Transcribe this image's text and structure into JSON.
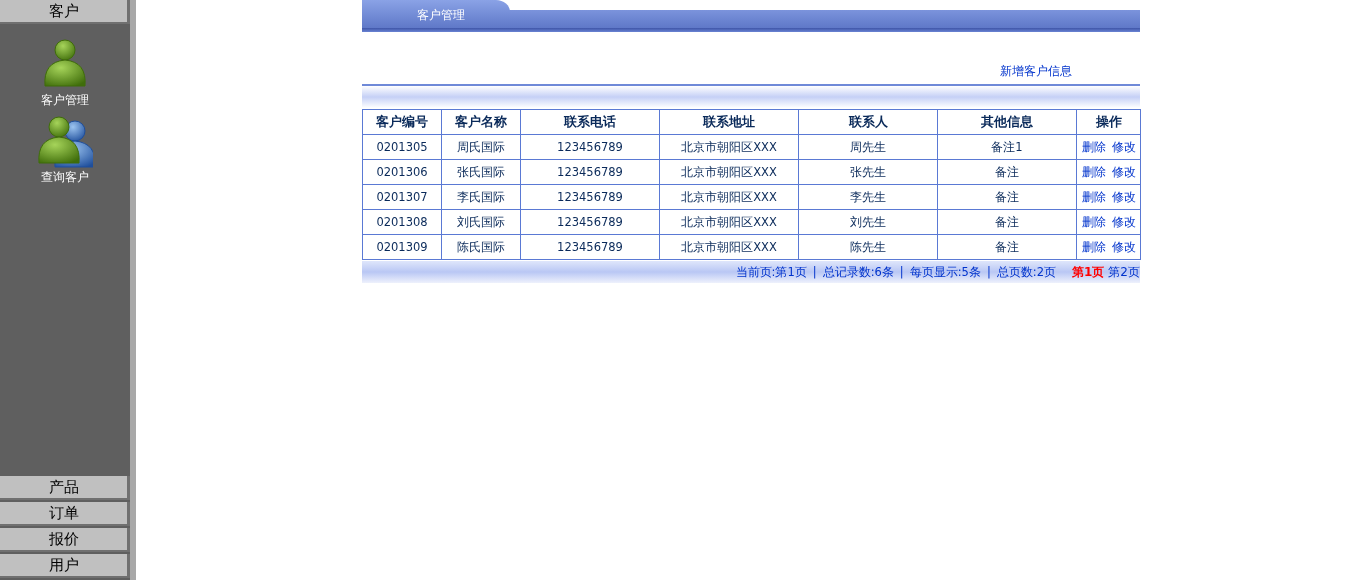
{
  "sidebar": {
    "open_section": "客户",
    "items": [
      {
        "label": "客户管理",
        "kind": "single"
      },
      {
        "label": "查询客户",
        "kind": "group"
      }
    ],
    "sections": [
      "产品",
      "订单",
      "报价",
      "用户"
    ]
  },
  "header": {
    "tab": "客户管理"
  },
  "add_link": "新增客户信息",
  "table": {
    "columns": [
      "客户编号",
      "客户名称",
      "联系电话",
      "联系地址",
      "联系人",
      "其他信息",
      "操作"
    ],
    "rows": [
      {
        "cells": [
          "0201305",
          "周氏国际",
          "123456789",
          "北京市朝阳区XXX",
          "周先生",
          "备注1"
        ],
        "actions": [
          "删除",
          "修改"
        ]
      },
      {
        "cells": [
          "0201306",
          "张氏国际",
          "123456789",
          "北京市朝阳区XXX",
          "张先生",
          "备注"
        ],
        "actions": [
          "删除",
          "修改"
        ]
      },
      {
        "cells": [
          "0201307",
          "李氏国际",
          "123456789",
          "北京市朝阳区XXX",
          "李先生",
          "备注"
        ],
        "actions": [
          "删除",
          "修改"
        ]
      },
      {
        "cells": [
          "0201308",
          "刘氏国际",
          "123456789",
          "北京市朝阳区XXX",
          "刘先生",
          "备注"
        ],
        "actions": [
          "删除",
          "修改"
        ]
      },
      {
        "cells": [
          "0201309",
          "陈氏国际",
          "123456789",
          "北京市朝阳区XXX",
          "陈先生",
          "备注"
        ],
        "actions": [
          "删除",
          "修改"
        ]
      }
    ]
  },
  "pager": {
    "separator": "|",
    "info": [
      "当前页:第1页",
      "总记录数:6条",
      "每页显示:5条",
      "总页数:2页"
    ],
    "pages": [
      {
        "label": "第1页",
        "selected": true
      },
      {
        "label": "第2页",
        "selected": false
      }
    ]
  }
}
